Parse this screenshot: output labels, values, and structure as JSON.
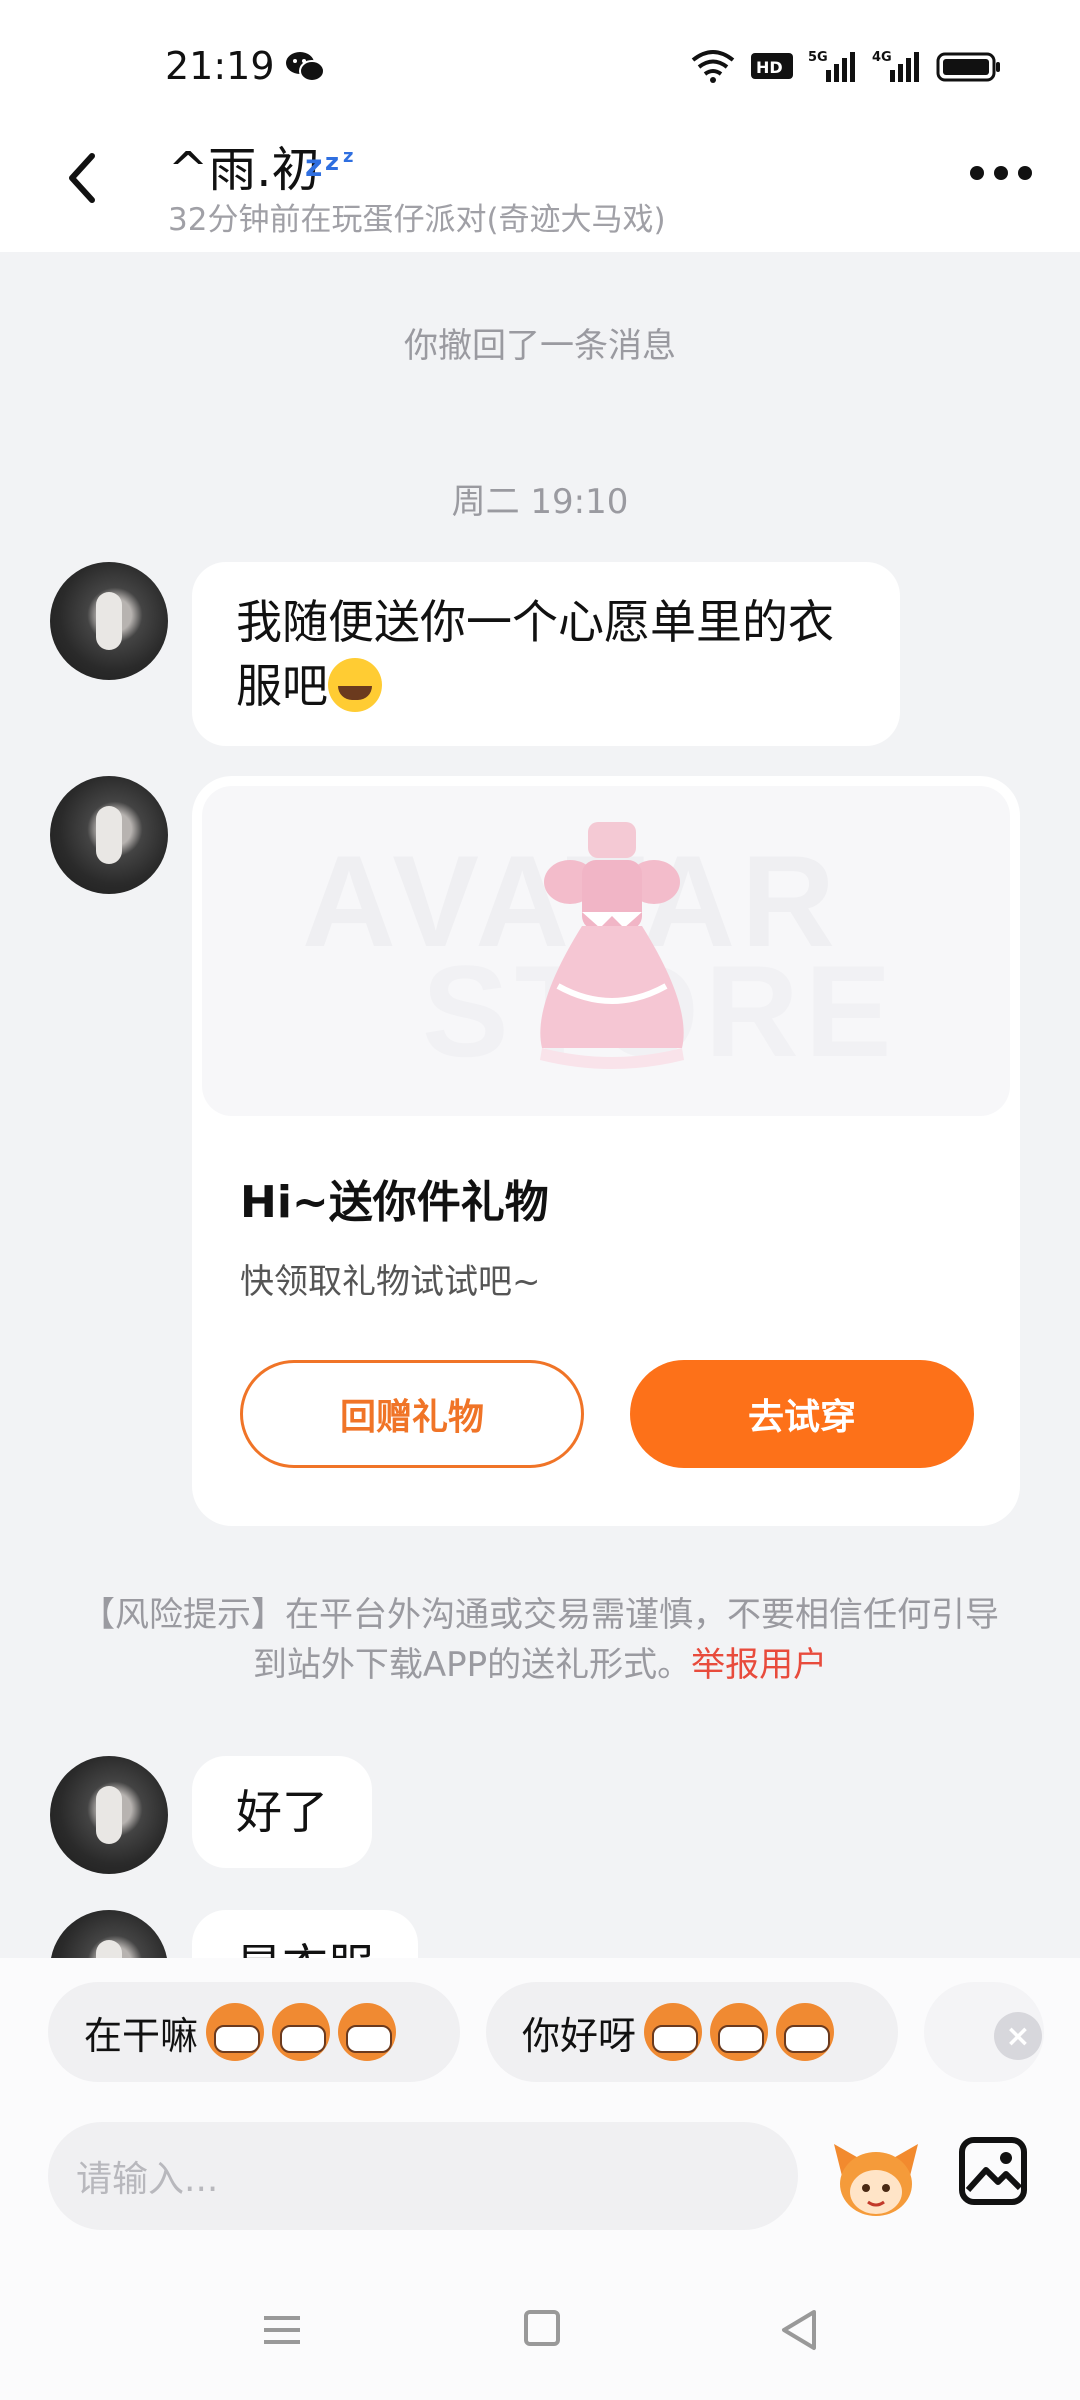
{
  "status_bar": {
    "time": "21:19",
    "icons": [
      "wechat-icon",
      "wifi-icon",
      "hd-icon",
      "5g-signal-icon",
      "4g-signal-icon",
      "battery-icon"
    ],
    "hd_label": "HD",
    "net1_label": "5G",
    "net2_label": "4G"
  },
  "header": {
    "title": "^雨.初",
    "status": "32分钟前在玩蛋仔派对(奇迹大马戏)"
  },
  "chat": {
    "recall_notice": "你撤回了一条消息",
    "timestamp": "周二 19:10",
    "message1": "我随便送你一个心愿单里的衣服吧",
    "gift_card": {
      "watermark_line1": "AVATAR",
      "watermark_line2": "STORE",
      "title": "Hi~送你件礼物",
      "subtitle": "快领取礼物试试吧~",
      "return_gift_label": "回赠礼物",
      "try_on_label": "去试穿"
    },
    "risk_tip": "【风险提示】在平台外沟通或交易需谨慎，不要相信任何引导到站外下载APP的送礼形式。",
    "report_label": "举报用户",
    "message2": "好了",
    "message3_partial": "是衣服"
  },
  "quick_replies": [
    {
      "text": "在干嘛"
    },
    {
      "text": "你好呀"
    }
  ],
  "input": {
    "placeholder": "请输入..."
  },
  "colors": {
    "accent": "#fd7119",
    "report": "#e84b3c",
    "background": "#f2f3f5"
  }
}
